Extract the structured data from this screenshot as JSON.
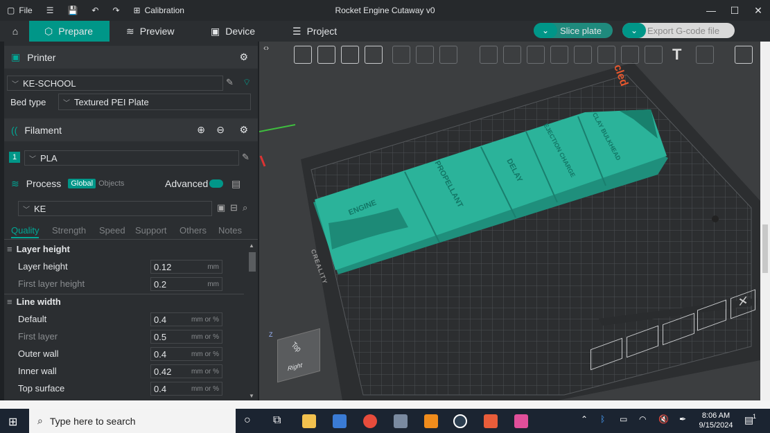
{
  "app": {
    "title": "Rocket Engine Cutaway v0",
    "file_menu": "File",
    "calibration": "Calibration"
  },
  "tabs": [
    {
      "label": "Prepare"
    },
    {
      "label": "Preview"
    },
    {
      "label": "Device"
    },
    {
      "label": "Project"
    }
  ],
  "actions": {
    "slice": "Slice plate",
    "export": "Export G-code file"
  },
  "printer": {
    "header": "Printer",
    "selected": "KE-SCHOOL",
    "bed_type_label": "Bed type",
    "bed_type_value": "Textured PEI Plate"
  },
  "filament": {
    "header": "Filament",
    "slot": "1",
    "selected": "PLA"
  },
  "process": {
    "header": "Process",
    "global": "Global",
    "objects": "Objects",
    "advanced": "Advanced",
    "preset": "KE"
  },
  "subtabs": [
    "Quality",
    "Strength",
    "Speed",
    "Support",
    "Others",
    "Notes"
  ],
  "groups": {
    "layer_height": {
      "title": "Layer height",
      "rows": [
        {
          "label": "Layer height",
          "value": "0.12",
          "unit": "mm"
        },
        {
          "label": "First layer height",
          "value": "0.2",
          "unit": "mm"
        }
      ]
    },
    "line_width": {
      "title": "Line width",
      "rows": [
        {
          "label": "Default",
          "value": "0.4",
          "unit": "mm or %"
        },
        {
          "label": "First layer",
          "value": "0.5",
          "unit": "mm or %"
        },
        {
          "label": "Outer wall",
          "value": "0.4",
          "unit": "mm or %"
        },
        {
          "label": "Inner wall",
          "value": "0.42",
          "unit": "mm or %"
        },
        {
          "label": "Top surface",
          "value": "0.4",
          "unit": "mm or %"
        }
      ]
    }
  },
  "viewport": {
    "bed_brand": "CREALITY",
    "part_labels": [
      "ENGINE",
      "PROPELLANT",
      "DELAY",
      "EJECTION CHARGE",
      "CLAY BULKHEAD"
    ],
    "orientation_top": "Top",
    "orientation_right": "Right",
    "axis_z": "Z",
    "partial_label": "cled"
  },
  "taskbar": {
    "search_placeholder": "Type here to search",
    "time": "8:06 AM",
    "date": "9/15/2024",
    "notification_count": "1"
  },
  "colors": {
    "accent": "#009688",
    "model": "#2bb39a",
    "bed": "#3a3c3e"
  }
}
